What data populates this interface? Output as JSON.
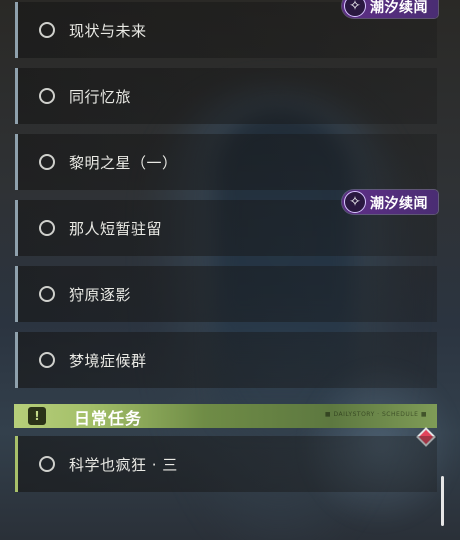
{
  "quests": [
    {
      "label": "现状与未来"
    },
    {
      "label": "同行忆旅"
    },
    {
      "label": "黎明之星（一）"
    },
    {
      "label": "那人短暂驻留"
    },
    {
      "label": "狩原逐影"
    },
    {
      "label": "梦境症候群"
    }
  ],
  "tags": [
    {
      "label": "潮汐续闻",
      "icon": "sparkle-icon"
    },
    {
      "label": "潮汐续闻",
      "icon": "sparkle-icon"
    }
  ],
  "daily_section": {
    "title": "日常任务",
    "icon_glyph": "!",
    "small_text": "■ DAILYSTORY · SCHEDULE ■"
  },
  "daily_quests": [
    {
      "label": "科学也疯狂 · 三"
    }
  ],
  "colors": {
    "quest_bar": "#8fa1ad",
    "daily_bar": "#a8c06a",
    "tag_bg": "#5e2f86",
    "section_bg": "#a3bf69",
    "alert_diamond": "#e1445c"
  }
}
